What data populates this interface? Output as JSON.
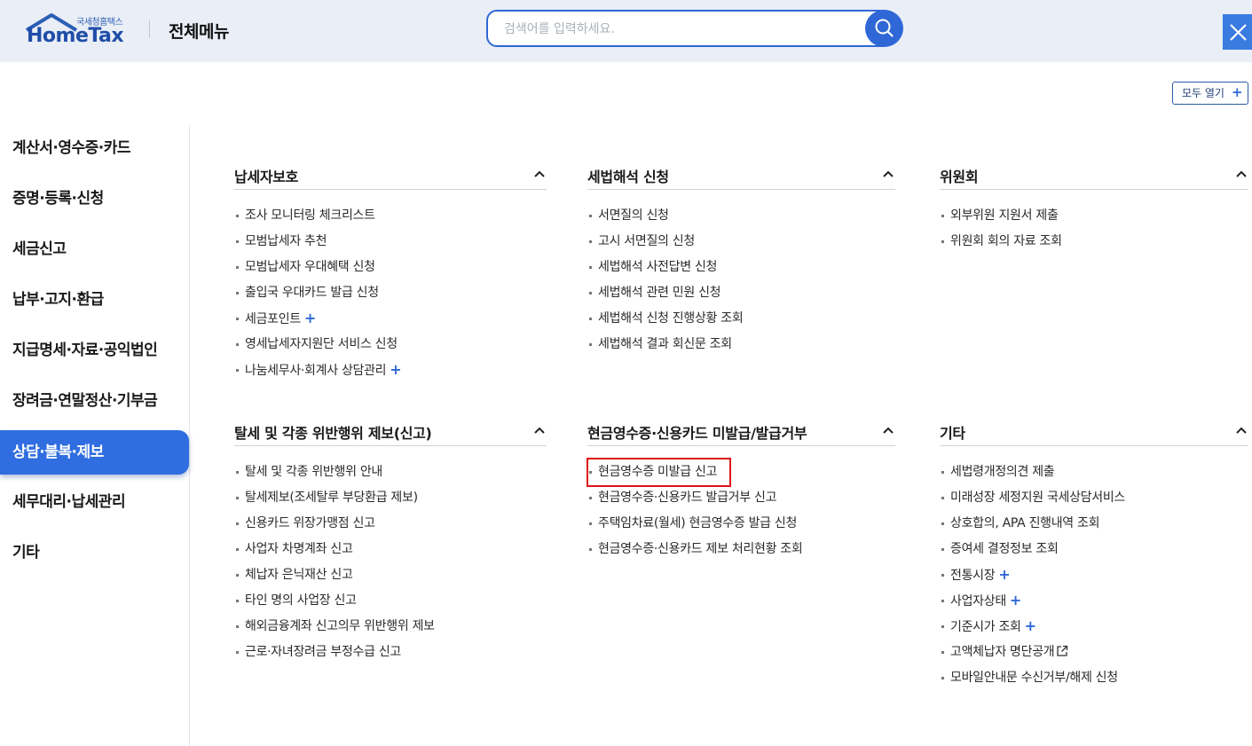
{
  "header": {
    "logo_small": "국세청홈택스",
    "logo_main": "HomeTax",
    "title": "전체메뉴",
    "search_placeholder": "검색어를 입력하세요.",
    "search_icon": "search-icon",
    "close_icon": "close-icon"
  },
  "toolbar": {
    "open_all_label": "모두 열기",
    "open_all_plus": "+"
  },
  "sidebar": {
    "items": [
      {
        "label": "계산서·영수증·카드",
        "active": false
      },
      {
        "label": "증명·등록·신청",
        "active": false
      },
      {
        "label": "세금신고",
        "active": false
      },
      {
        "label": "납부·고지·환급",
        "active": false
      },
      {
        "label": "지급명세·자료·공익법인",
        "active": false
      },
      {
        "label": "장려금·연말정산·기부금",
        "active": false
      },
      {
        "label": "상담·불복·제보",
        "active": true
      },
      {
        "label": "세무대리·납세관리",
        "active": false
      },
      {
        "label": "기타",
        "active": false
      }
    ]
  },
  "sections": [
    {
      "title": "납세자보호",
      "items": [
        {
          "label": "조사 모니터링 체크리스트"
        },
        {
          "label": "모범납세자 추천"
        },
        {
          "label": "모범납세자 우대혜택 신청"
        },
        {
          "label": "출입국 우대카드 발급 신청"
        },
        {
          "label": "세금포인트",
          "plus": "+"
        },
        {
          "label": "영세납세자지원단 서비스 신청"
        },
        {
          "label": "나눔세무사·회계사 상담관리",
          "plus": "+"
        }
      ]
    },
    {
      "title": "세법해석 신청",
      "items": [
        {
          "label": "서면질의 신청"
        },
        {
          "label": "고시 서면질의 신청"
        },
        {
          "label": "세법해석 사전답변 신청"
        },
        {
          "label": "세법해석 관련 민원 신청"
        },
        {
          "label": "세법해석 신청 진행상황 조회"
        },
        {
          "label": "세법해석 결과 회신문 조회"
        }
      ]
    },
    {
      "title": "위원회",
      "items": [
        {
          "label": "외부위원 지원서 제출"
        },
        {
          "label": "위원회 회의 자료 조회"
        }
      ]
    },
    {
      "title": "탈세 및 각종 위반행위 제보(신고)",
      "items": [
        {
          "label": "탈세 및 각종 위반행위 안내"
        },
        {
          "label": "탈세제보(조세탈루 부당환급 제보)"
        },
        {
          "label": "신용카드 위장가맹점 신고"
        },
        {
          "label": "사업자 차명계좌 신고"
        },
        {
          "label": "체납자 은닉재산 신고"
        },
        {
          "label": "타인 명의 사업장 신고"
        },
        {
          "label": "해외금융계좌 신고의무 위반행위 제보"
        },
        {
          "label": "근로·자녀장려금 부정수급 신고"
        }
      ]
    },
    {
      "title": "현금영수증·신용카드 미발급/발급거부",
      "items": [
        {
          "label": "현금영수증 미발급 신고"
        },
        {
          "label": "현금영수증·신용카드 발급거부 신고"
        },
        {
          "label": "주택임차료(월세) 현금영수증 발급 신청"
        },
        {
          "label": "현금영수증·신용카드 제보 처리현황 조회"
        }
      ]
    },
    {
      "title": "기타",
      "items": [
        {
          "label": "세법령개정의견 제출"
        },
        {
          "label": "미래성장 세정지원 국세상담서비스"
        },
        {
          "label": "상호합의, APA 진행내역 조회"
        },
        {
          "label": "증여세 결정정보 조회"
        },
        {
          "label": "전통시장",
          "plus": "+"
        },
        {
          "label": "사업자상태",
          "plus": "+"
        },
        {
          "label": "기준시가 조회",
          "plus": "+"
        },
        {
          "label": "고액체납자 명단공개",
          "ext": "external-link-icon"
        },
        {
          "label": "모바일안내문 수신거부/해제 신청"
        }
      ]
    }
  ],
  "colors": {
    "accent": "#2f6de0",
    "header_bg": "#e9eef7",
    "highlight": "#e0121a"
  }
}
